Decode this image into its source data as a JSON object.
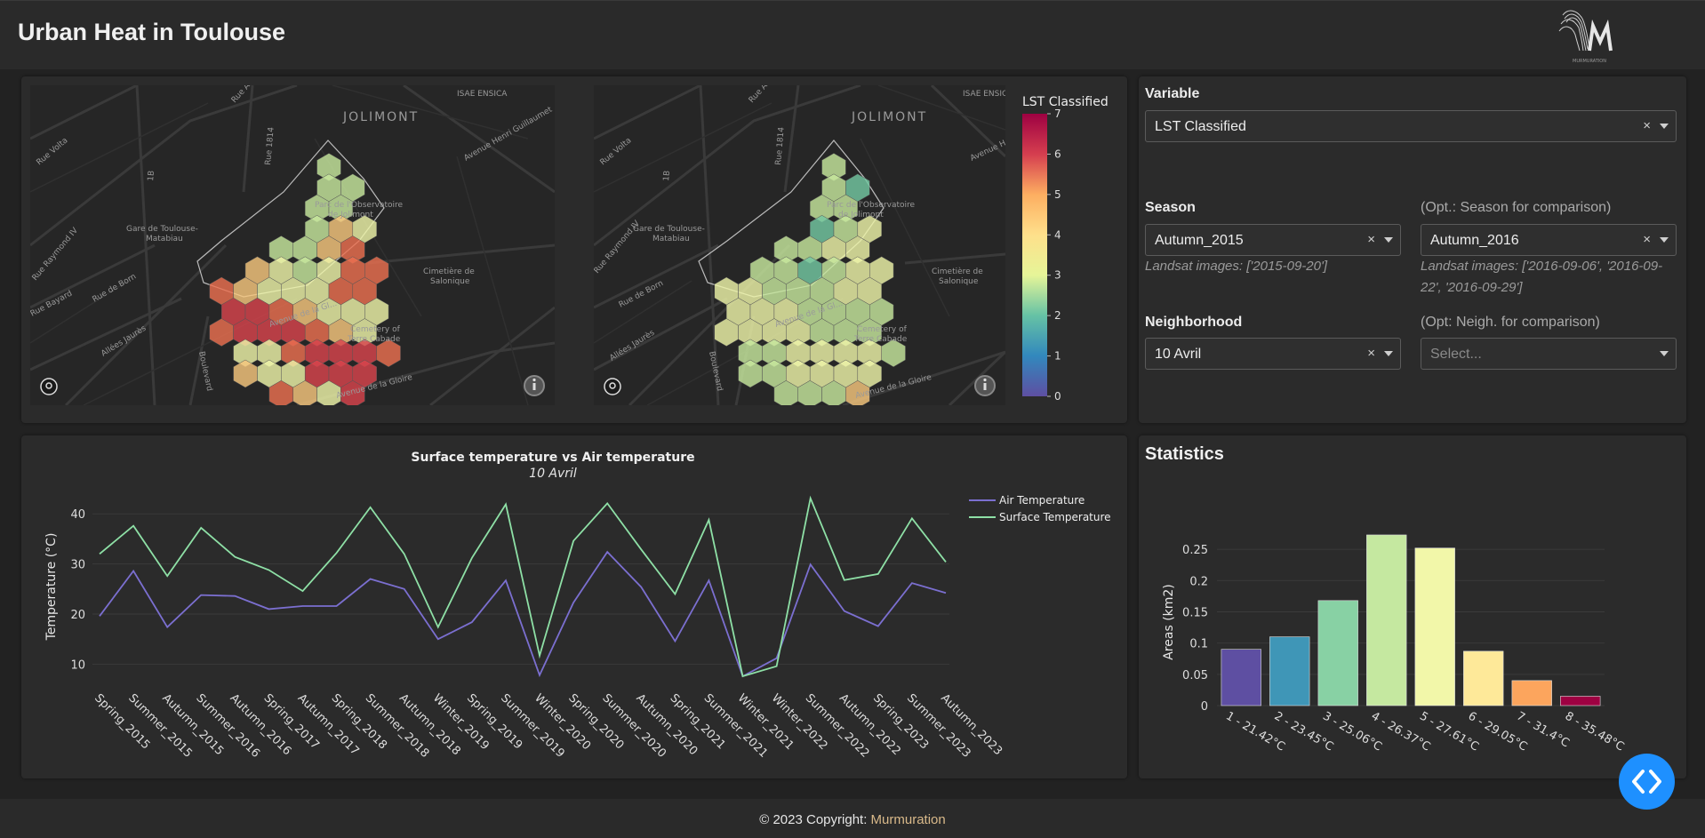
{
  "header": {
    "title": "Urban Heat in Toulouse",
    "logo_text": "MURMURATION"
  },
  "maps": {
    "labels": {
      "jolimont": "JOLIMONT",
      "isae": "ISAE ENSICA",
      "arago": "Rue Arago",
      "rue1814": "Rue 1814",
      "henri": "Avenue Henri Guillaumet",
      "volta": "Rue Volta",
      "b1": "1B",
      "gare": "Gare de Toulouse-",
      "gare2": "Matabiau",
      "observ": "Parc de l'Observatoire",
      "observ2": "de Jolimont",
      "cimetiere": "Cimetière de",
      "cimetiere2": "Salonique",
      "raymond": "Rue Raymond IV",
      "bayard": "Rue Bayard",
      "born": "Rue de Born",
      "jaures": "Allées Jaurès",
      "cemetery": "Cemetery of",
      "cemetery2": "Terre Cabade",
      "lagloire": "Avenue de la Gloire",
      "boulevard": "Boulevard",
      "avgloire2": "Avenue de la Gl..."
    },
    "left_hex_classes": [
      3,
      3,
      3,
      3,
      3,
      3,
      5,
      4,
      3,
      3,
      5,
      6,
      5,
      4,
      3,
      4,
      6,
      6,
      6,
      5,
      4,
      4,
      4,
      6,
      6,
      7,
      7,
      6,
      5,
      4,
      4,
      4,
      6,
      7,
      7,
      7,
      6,
      5,
      4,
      4,
      4,
      6,
      7,
      7,
      7,
      6,
      5,
      4,
      4,
      7,
      7,
      7,
      6,
      5,
      4,
      7,
      7,
      6,
      5,
      6
    ],
    "right_hex_classes": [
      3,
      3,
      2,
      3,
      3,
      2,
      3,
      4,
      3,
      3,
      4,
      4,
      3,
      3,
      2,
      3,
      4,
      4,
      4,
      4,
      3,
      3,
      3,
      4,
      4,
      4,
      4,
      4,
      3,
      3,
      3,
      3,
      4,
      4,
      4,
      4,
      3,
      3,
      3,
      3,
      3,
      4,
      4,
      4,
      4,
      3,
      3,
      3,
      4,
      4,
      4,
      4,
      3,
      3,
      3,
      5,
      5,
      6,
      5,
      4
    ],
    "colorbar": {
      "title": "LST Classified",
      "ticks": [
        "0",
        "1",
        "2",
        "3",
        "4",
        "5",
        "6",
        "7"
      ]
    }
  },
  "controls": {
    "variable_label": "Variable",
    "variable_value": "LST Classified",
    "season_label": "Season",
    "season_value": "Autumn_2015",
    "season_note": "Landsat images: ['2015-09-20']",
    "season_cmp_label": "(Opt.: Season for comparison)",
    "season_cmp_value": "Autumn_2016",
    "season_cmp_note1": "Landsat images: ['2016-09-06', '2016-09-",
    "season_cmp_note2": "22', '2016-09-29']",
    "neigh_label": "Neighborhood",
    "neigh_value": "10 Avril",
    "neigh_cmp_label": "(Opt: Neigh. for comparison)",
    "neigh_cmp_placeholder": "Select...",
    "clear_glyph": "×"
  },
  "chart_data": [
    {
      "type": "line",
      "title": "Surface temperature vs Air temperature",
      "subtitle": "10 Avril",
      "xlabel": "",
      "ylabel": "Temperature (°C)",
      "ylim": [
        6,
        45
      ],
      "yticks": [
        10,
        20,
        30,
        40
      ],
      "grid": true,
      "legend": "top-right",
      "categories": [
        "Spring_2015",
        "Summer_2015",
        "Autumn_2015",
        "Summer_2016",
        "Autumn_2016",
        "Spring_2017",
        "Autumn_2017",
        "Spring_2018",
        "Summer_2018",
        "Autumn_2018",
        "Winter_2019",
        "Spring_2019",
        "Summer_2019",
        "Winter_2020",
        "Spring_2020",
        "Summer_2020",
        "Autumn_2020",
        "Spring_2021",
        "Summer_2021",
        "Winter_2021",
        "Winter_2022",
        "Summer_2022",
        "Autumn_2022",
        "Spring_2023",
        "Summer_2023",
        "Autumn_2023"
      ],
      "series": [
        {
          "name": "Air Temperature",
          "color": "#7b6fd0",
          "values": [
            19.6,
            28.6,
            17.4,
            23.8,
            23.6,
            21.0,
            21.6,
            21.6,
            27.0,
            25.0,
            15.0,
            18.4,
            26.7,
            7.8,
            22.3,
            32.4,
            25.4,
            14.6,
            26.7,
            7.6,
            11.2,
            29.9,
            20.6,
            17.6,
            26.2,
            24.2
          ]
        },
        {
          "name": "Surface Temperature",
          "color": "#8ee0a6",
          "values": [
            32.0,
            37.6,
            27.6,
            37.2,
            31.4,
            28.8,
            24.6,
            32.2,
            41.3,
            32.0,
            17.4,
            31.2,
            41.9,
            11.7,
            34.6,
            42.1,
            32.9,
            24.0,
            38.8,
            7.6,
            9.6,
            43.1,
            26.8,
            28.0,
            39.1,
            30.4
          ]
        }
      ]
    },
    {
      "type": "bar",
      "title": "",
      "xlabel": "",
      "ylabel": "Areas (km2)",
      "ylim": [
        0,
        0.29
      ],
      "yticks": [
        "0",
        "0.05",
        "0.1",
        "0.15",
        "0.2",
        "0.25"
      ],
      "ytick_values": [
        0,
        0.05,
        0.1,
        0.15,
        0.2,
        0.25
      ],
      "grid": true,
      "categories": [
        "1 - 21.42°C",
        "2 - 23.45°C",
        "3 - 25.06°C",
        "4 - 26.37°C",
        "5 - 27.61°C",
        "6 - 29.05°C",
        "7 - 31.4°C",
        "8 - 35.48°C"
      ],
      "values": [
        0.09,
        0.11,
        0.168,
        0.273,
        0.252,
        0.087,
        0.04,
        0.015
      ],
      "colors": [
        "#5e4fa2",
        "#3f96b7",
        "#88d1a4",
        "#c5e8a0",
        "#f2f7a9",
        "#fee999",
        "#fca55d",
        "#9e0142"
      ]
    }
  ],
  "statistics": {
    "title": "Statistics"
  },
  "footer": {
    "text": "© 2023 Copyright: ",
    "brand": "Murmuration"
  }
}
